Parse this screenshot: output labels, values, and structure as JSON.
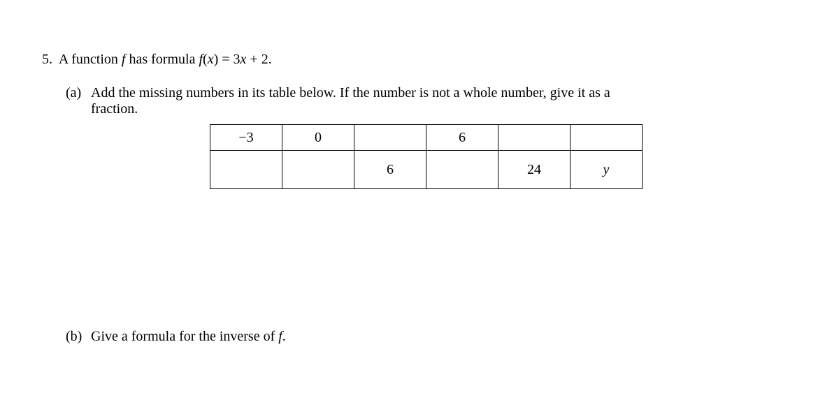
{
  "problem": {
    "number": "5.",
    "intro_prefix": "A function ",
    "intro_f": "f",
    "intro_mid": " has formula ",
    "formula_lhs": "f",
    "formula_paren_open": "(",
    "formula_x": "x",
    "formula_paren_close": ") = 3",
    "formula_x2": "x",
    "formula_tail": " + 2."
  },
  "part_a": {
    "label": "(a)",
    "text_line1": "Add the missing numbers in its table below.  If the number is not a whole number, give it as a",
    "text_line2": "fraction."
  },
  "table": {
    "row1": [
      "−3",
      "0",
      "",
      "6",
      "",
      ""
    ],
    "row2": [
      "",
      "",
      "6",
      "",
      "24",
      "y"
    ]
  },
  "part_b": {
    "label": "(b)",
    "text_prefix": "Give a formula for the inverse of ",
    "text_f": "f",
    "text_suffix": "."
  }
}
